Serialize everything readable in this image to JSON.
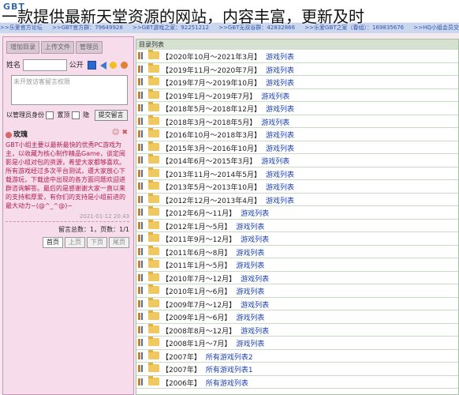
{
  "header": {
    "logo": "GBT",
    "overlay_caption": "一款提供最新天堂资源的网站，内容丰富，更新及时"
  },
  "ticker": [
    ">>乐爱官方论坛",
    ">>GBT官方群：79649928",
    ">>GBT游戏之家：92251212",
    ">>GBT无双谷群：42832866",
    ">>乐爱GBT之家（春组）：169835676",
    ">>HQ小组会员交流1群"
  ],
  "left_panel": {
    "buttons": [
      "增加目录",
      "上传文件",
      "管理员"
    ],
    "name_label": "姓名",
    "public_label": "公开",
    "textarea_placeholder": "未开放访客留言权限",
    "admin_label": "以管理员身份",
    "top_label": "置顶",
    "hide_label": "隐",
    "submit_label": "提交留言",
    "message": {
      "author": "玫瑰",
      "body": "GBT小组主要以最新最快的优秀PC游戏为主，以收藏为核心制作精品Game，谈定阅影是小组对包的资源，希望大家都够喜欢。所有游戏经过多次平台测试，遵大家放心下载游玩，下载途中出现的各方面问题欢迎进群咨询解答。最后的是感谢谢大家一直以来的支持和厚爱，有你们的支持是小组前进的最大动力~(@^_^@)~",
      "time": "2021-01-12 20:43"
    },
    "counts": "留言总数：1，页数：1/1",
    "pager": [
      "首页",
      "上页",
      "下页",
      "尾页"
    ]
  },
  "file_list": {
    "header": "目录列表",
    "rows": [
      {
        "period": "【2020年10月～2021年3月】",
        "label": "游戏列表"
      },
      {
        "period": "【2019年11月～2020年7月】",
        "label": "游戏列表"
      },
      {
        "period": "【2019年7月～2019年10月】",
        "label": "游戏列表"
      },
      {
        "period": "【2019年1月～2019年7月】",
        "label": "游戏列表"
      },
      {
        "period": "【2018年5月～2018年12月】",
        "label": "游戏列表"
      },
      {
        "period": "【2018年3月～2018年5月】",
        "label": "游戏列表"
      },
      {
        "period": "【2016年10月～2018年3月】",
        "label": "游戏列表"
      },
      {
        "period": "【2015年3月～2016年10月】",
        "label": "游戏列表"
      },
      {
        "period": "【2014年6月～2015年3月】",
        "label": "游戏列表"
      },
      {
        "period": "【2013年11月～2014年5月】",
        "label": "游戏列表"
      },
      {
        "period": "【2013年5月～2013年10月】",
        "label": "游戏列表"
      },
      {
        "period": "【2012年12月～2013年4月】",
        "label": "游戏列表"
      },
      {
        "period": "【2012年6月～11月】",
        "label": "游戏列表"
      },
      {
        "period": "【2012年1月～5月】",
        "label": "游戏列表"
      },
      {
        "period": "【2011年9月～12月】",
        "label": "游戏列表"
      },
      {
        "period": "【2011年6月～8月】",
        "label": "游戏列表"
      },
      {
        "period": "【2011年1月～5月】",
        "label": "游戏列表"
      },
      {
        "period": "【2010年7月～12月】",
        "label": "游戏列表"
      },
      {
        "period": "【2010年1月～6月】",
        "label": "游戏列表"
      },
      {
        "period": "【2009年7月～12月】",
        "label": "游戏列表"
      },
      {
        "period": "【2009年1月～6月】",
        "label": "游戏列表"
      },
      {
        "period": "【2008年8月～12月】",
        "label": "游戏列表"
      },
      {
        "period": "【2008年1月～7月】",
        "label": "游戏列表"
      },
      {
        "period": "【2007年】",
        "label": "所有游戏列表2"
      },
      {
        "period": "【2007年】",
        "label": "所有游戏列表1"
      },
      {
        "period": "【2006年】",
        "label": "所有游戏列表"
      }
    ]
  }
}
